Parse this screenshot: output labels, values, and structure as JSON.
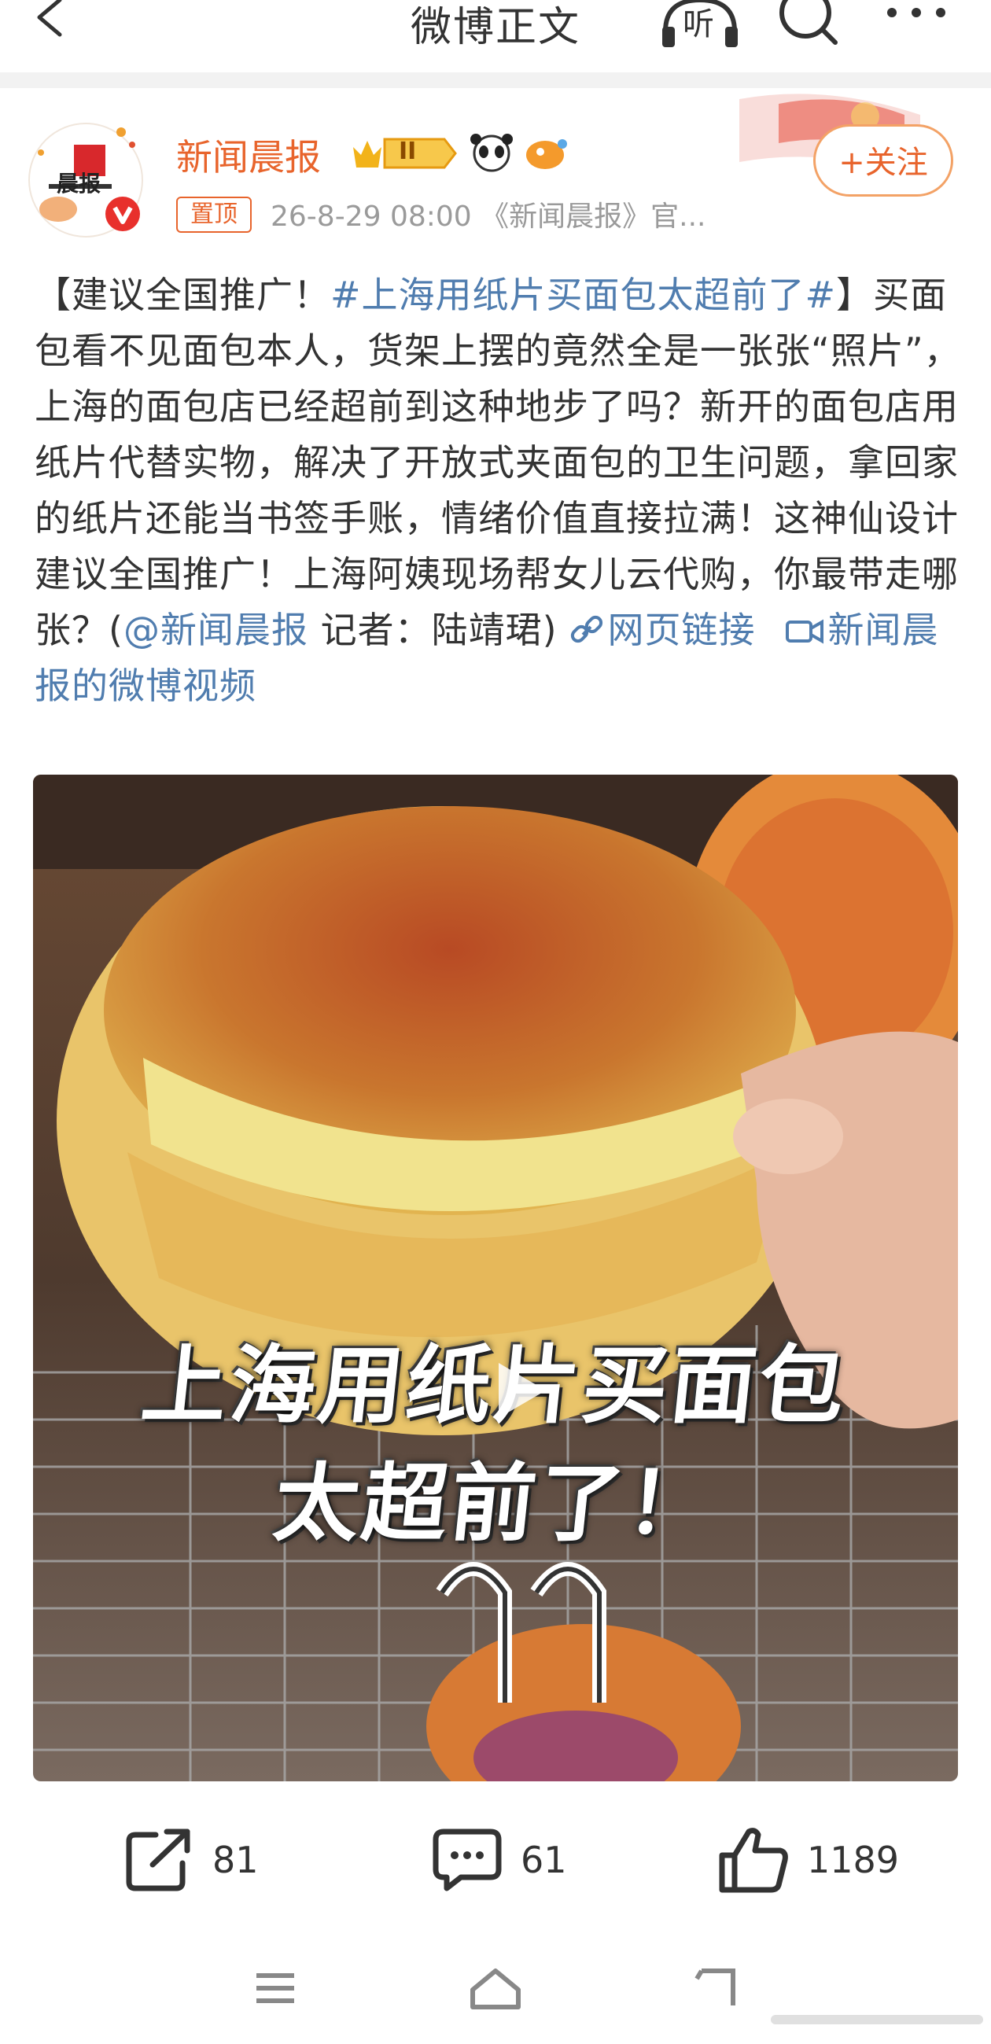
{
  "topbar": {
    "title": "微博正文",
    "listen_label": "听"
  },
  "author": {
    "name": "新闻晨报",
    "level_badge": "II",
    "pinned_label": "置顶",
    "meta": "26-8-29 08:00 《新闻晨报》官...",
    "follow_label": "+关注",
    "avatar_text": "晨报"
  },
  "post": {
    "open_bracket": "【建议全国推广！",
    "hashtag": "#上海用纸片买面包太超前了#",
    "body_1": "】买面包看不见面包本人，货架上摆的竟然全是一张张“照片”，上海的面包店已经超前到这种地步了吗？新开的面包店用纸片代替实物，解决了开放式夹面包的卫生问题，拿回家的纸片还能当书签手账，情绪价值直接拉满！这神仙设计建议全国推广！上海阿姨现场帮女儿云代购，你最带走哪张？(",
    "mention": "@新闻晨报",
    "body_2": " 记者：陆靖珺)",
    "web_link": "网页链接",
    "video_link": "新闻晨报的微博视频"
  },
  "video": {
    "caption_line1": "上海用纸片买面包",
    "caption_line2": "太超前了！"
  },
  "actions": {
    "repost_count": "81",
    "comment_count": "61",
    "like_count": "1189"
  }
}
